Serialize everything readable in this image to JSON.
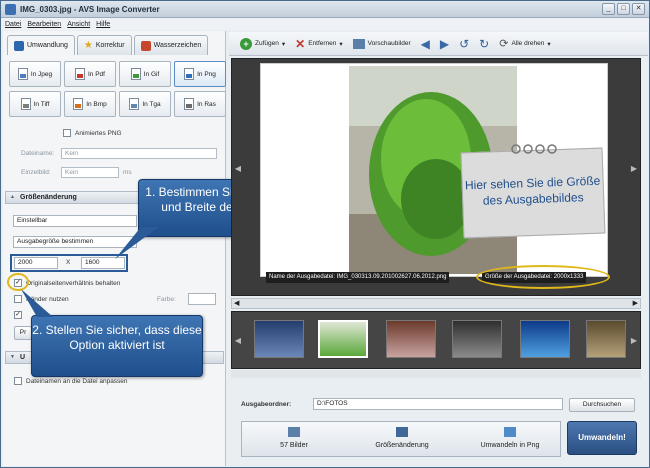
{
  "window": {
    "title": "IMG_0303.jpg - AVS Image Converter",
    "minimize": "_",
    "maximize": "□",
    "close": "✕"
  },
  "menu": [
    "Datei",
    "Bearbeiten",
    "Ansicht",
    "Hilfe"
  ],
  "tabs": [
    "Umwandlung",
    "Korrektur",
    "Wasserzeichen"
  ],
  "formats": [
    {
      "label": "In Jpeg",
      "color": "#4a7fc0"
    },
    {
      "label": "In Pdf",
      "color": "#c23a2b"
    },
    {
      "label": "In Gif",
      "color": "#3f9a3f"
    },
    {
      "label": "In Png",
      "color": "#2d6fb8"
    },
    {
      "label": "In Tiff",
      "color": "#7d7d7d"
    },
    {
      "label": "In Bmp",
      "color": "#d46e1e"
    },
    {
      "label": "In Tga",
      "color": "#5e8ab0"
    },
    {
      "label": "In Ras",
      "color": "#6b6b6b"
    }
  ],
  "options": {
    "animated_png": "Animiertes PNG",
    "filename_label": "Dateiname:",
    "filename_value": "Kein",
    "insert_label": "Einzelbild:",
    "insert_value": "Kein",
    "insert_unit": "ms"
  },
  "resize": {
    "title": "Größenänderung",
    "mode": "Einstellbar",
    "preset": "Ausgabegröße bestimmen",
    "width": "2000",
    "separator": "X",
    "height": "1600",
    "keep_ratio": "Originalseitenverhältnis behalten",
    "frame_label": "Ränder nutzen",
    "color_label": "Farbe:",
    "cut_label": "Pr"
  },
  "sections": {
    "collapsed_title": "U",
    "bottom_option": "Dateinamen an die Datei anpassen"
  },
  "callouts": {
    "first": "1. Bestimmen Sie die Höhe und Breite des Bildes",
    "second": "2. Stellen Sie sicher, dass diese Option aktiviert ist"
  },
  "toolbar": {
    "add": "Zufügen",
    "remove": "Entfernen",
    "preview": "Vorschaubilder",
    "rotate_all": "Alle drehen"
  },
  "preview": {
    "note": "Hier sehen Sie die Größe des Ausgabebildes",
    "output_name": "Name der Ausgabedatei: IMG_030313.09.201002627.06.2012.png",
    "output_size": "Größe der Ausgabedatei: 2000x1333"
  },
  "output": {
    "label": "Ausgabeordner:",
    "path": "D:\\FOTOS",
    "browse": "Durchsuchen"
  },
  "steps": [
    "57 Bilder",
    "Größenänderung",
    "Umwandeln in Png"
  ],
  "convert": "Umwandeln!"
}
